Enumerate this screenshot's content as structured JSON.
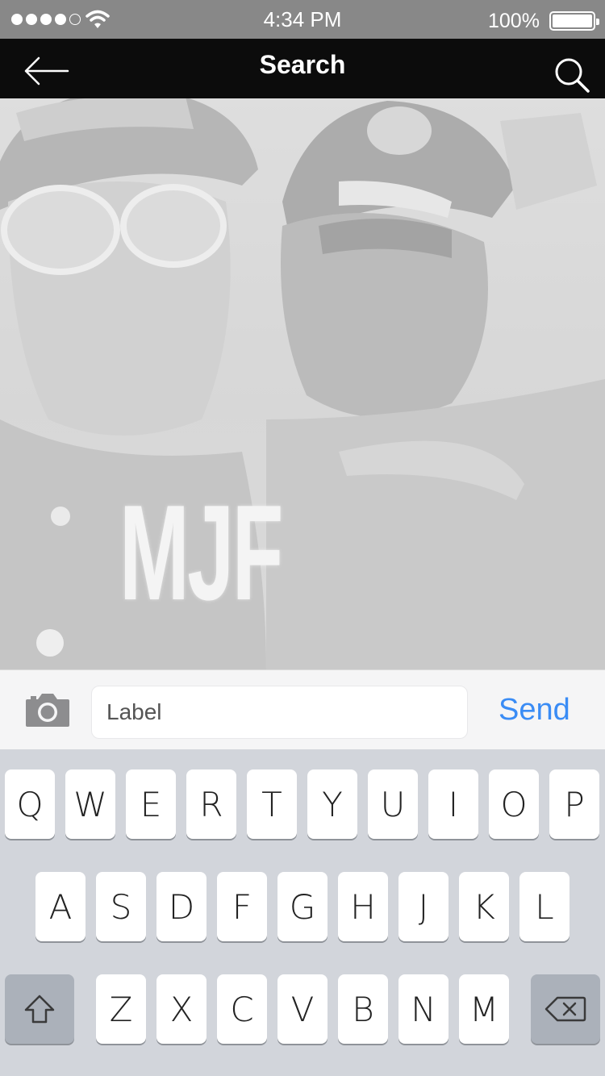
{
  "status_bar": {
    "signal_bars": 5,
    "signal_bars_filled": 4,
    "time": "4:34 PM",
    "battery_percent": "100%",
    "battery_level": 1.0
  },
  "nav": {
    "title": "Search",
    "back_icon": "arrow-left-icon",
    "search_icon": "magnifier-icon"
  },
  "photo": {
    "jacket_text": "MJF"
  },
  "compose": {
    "camera_icon": "camera-icon",
    "input_placeholder": "Label",
    "send_label": "Send"
  },
  "keyboard": {
    "row1": [
      "Q",
      "W",
      "E",
      "R",
      "T",
      "Y",
      "U",
      "I",
      "O",
      "P"
    ],
    "row2": [
      "A",
      "S",
      "D",
      "F",
      "G",
      "H",
      "J",
      "K",
      "L"
    ],
    "row3": [
      "Z",
      "X",
      "C",
      "V",
      "B",
      "N",
      "M"
    ],
    "shift_icon": "shift-icon",
    "delete_icon": "backspace-icon"
  },
  "colors": {
    "nav_background": "#0c0c0c",
    "send_blue": "#3a8cf5",
    "keyboard_background": "#d2d5db",
    "special_key": "#abb1ba"
  }
}
